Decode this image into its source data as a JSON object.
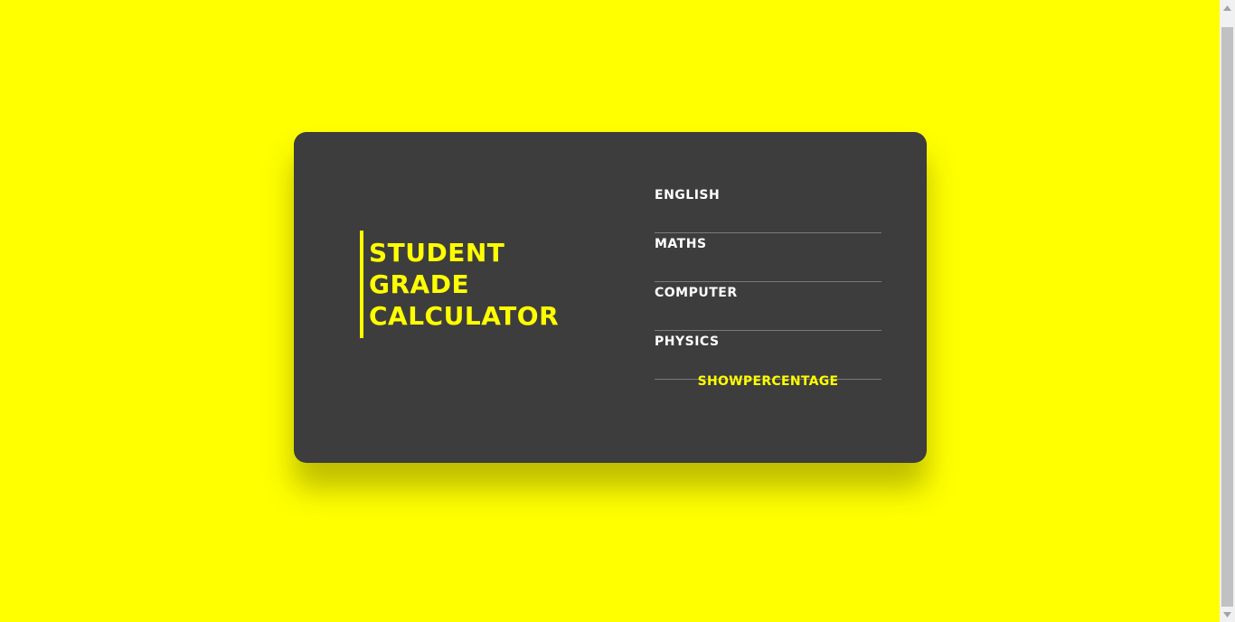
{
  "title": {
    "lines": [
      "STUDENT",
      "GRADE",
      "CALCULATOR"
    ]
  },
  "fields": [
    {
      "label": "ENGLISH",
      "value": ""
    },
    {
      "label": "MATHS",
      "value": ""
    },
    {
      "label": "COMPUTER",
      "value": ""
    },
    {
      "label": "PHYSICS",
      "value": ""
    }
  ],
  "button": {
    "label": "SHOWPERCENTAGE"
  },
  "colors": {
    "background": "#ffff00",
    "card": "#3d3d3d",
    "accent": "#ffff00",
    "label": "#ffffff"
  },
  "icons": {
    "scroll_up": "chevron-up-icon",
    "scroll_down": "chevron-down-icon"
  }
}
